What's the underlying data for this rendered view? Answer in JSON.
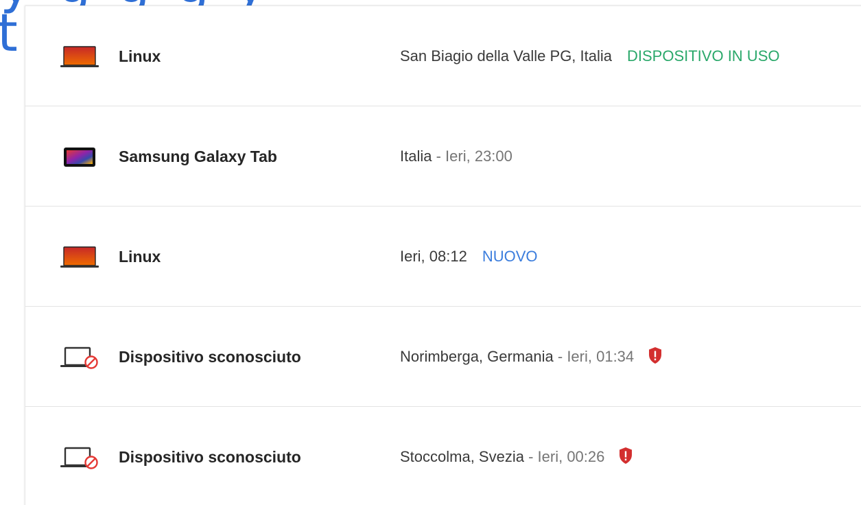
{
  "heading_fragment": "y g  g        g      y",
  "left_fragment": "t",
  "devices": [
    {
      "icon": "laptop-icon",
      "name": "Linux",
      "location": "San Biagio della Valle PG, Italia",
      "separator": "",
      "time": "",
      "status": "DISPOSITIVO IN USO"
    },
    {
      "icon": "tablet-icon",
      "name": "Samsung Galaxy Tab",
      "location": "Italia",
      "separator": " - ",
      "time": "Ieri, 23:00",
      "status": ""
    },
    {
      "icon": "laptop-icon",
      "name": "Linux",
      "location": "",
      "separator": "",
      "time": "Ieri, 08:12",
      "status": "NUOVO"
    },
    {
      "icon": "unknown-device-icon",
      "name": "Dispositivo sconosciuto",
      "location": "Norimberga, Germania",
      "separator": " - ",
      "time": "Ieri, 01:34",
      "status": "",
      "warning_icon": "shield-alert-icon"
    },
    {
      "icon": "unknown-device-icon",
      "name": "Dispositivo sconosciuto",
      "location": "Stoccolma, Svezia",
      "separator": " - ",
      "time": "Ieri, 00:26",
      "status": "",
      "warning_icon": "shield-alert-icon"
    }
  ],
  "colors": {
    "accent_blue": "#3b7ddd",
    "in_use_green": "#2aa86a",
    "warning_red": "#d32f2f",
    "laptop_red": "#d84315"
  }
}
